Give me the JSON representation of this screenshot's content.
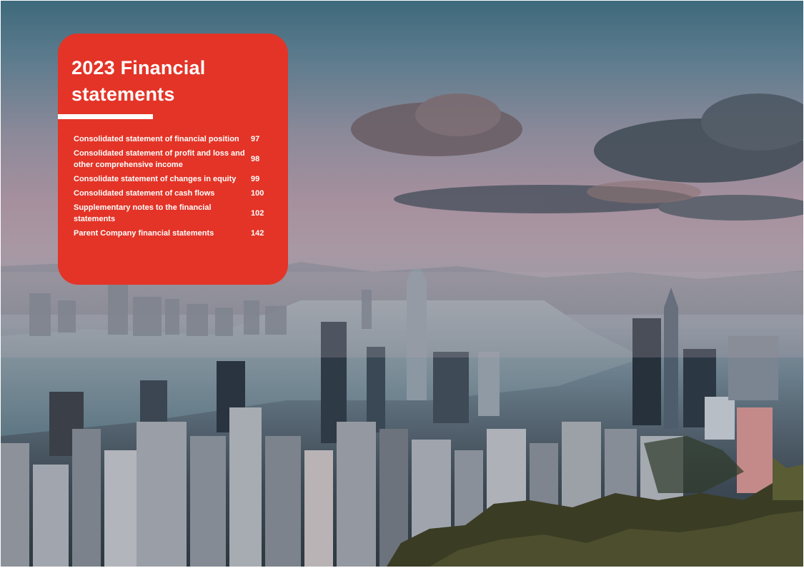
{
  "background": {
    "description_icon": "city-skyline-photo"
  },
  "toc": {
    "title": "2023 Financial statements",
    "accent_color": "#e33427",
    "items": [
      {
        "label": "Consolidated statement of financial position",
        "page": "97"
      },
      {
        "label": "Consolidated statement of profit and loss and other comprehensive income",
        "page": "98"
      },
      {
        "label": "Consolidate statement of changes in equity",
        "page": "99"
      },
      {
        "label": "Consolidated statement of cash flows",
        "page": "100"
      },
      {
        "label": "Supplementary notes to the financial statements",
        "page": "102"
      },
      {
        "label": "Parent Company financial statements",
        "page": "142"
      }
    ]
  }
}
